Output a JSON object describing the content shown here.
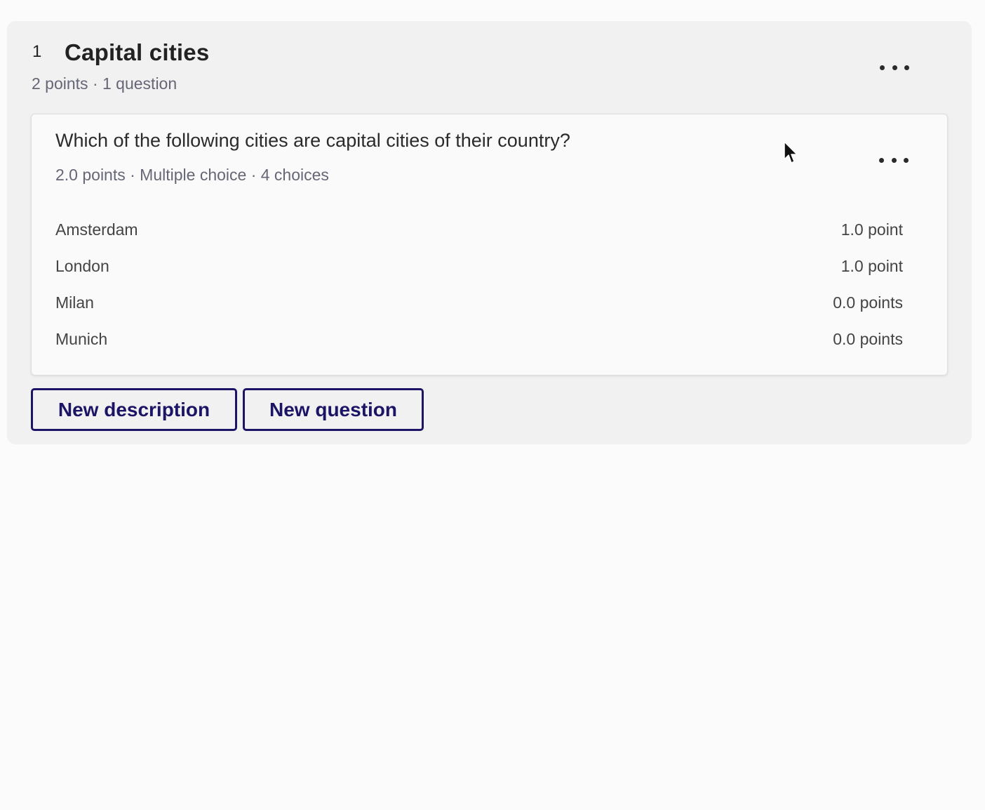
{
  "section": {
    "number": "1",
    "title": "Capital cities",
    "meta": "2 points · 1 question",
    "more_icon": "more-horizontal-icon"
  },
  "question": {
    "text": "Which of the following cities are capital cities of their country?",
    "meta": "2.0 points · Multiple choice · 4 choices",
    "more_icon": "more-horizontal-icon",
    "choices": [
      {
        "label": "Amsterdam",
        "points": "1.0 point"
      },
      {
        "label": "London",
        "points": "1.0 point"
      },
      {
        "label": "Milan",
        "points": "0.0 points"
      },
      {
        "label": "Munich",
        "points": "0.0 points"
      }
    ]
  },
  "actions": {
    "new_description": "New description",
    "new_question": "New question"
  },
  "colors": {
    "accent": "#1c1464",
    "section_bg": "#f1f1f2",
    "card_bg": "#fafafa",
    "page_bg": "#fbfbfb"
  }
}
